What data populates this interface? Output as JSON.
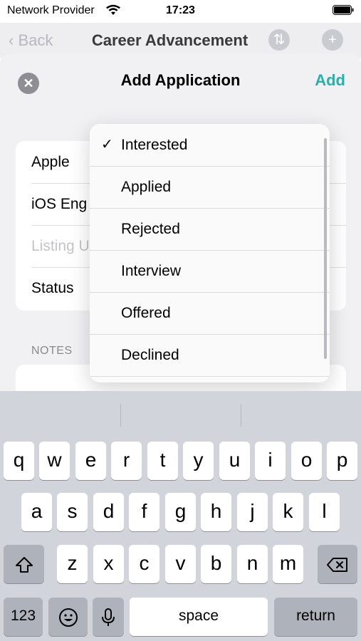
{
  "status_bar": {
    "carrier": "Network Provider",
    "time": "17:23"
  },
  "nav": {
    "back": "Back",
    "title": "Career Advancement"
  },
  "sheet": {
    "title": "Add Application",
    "add": "Add"
  },
  "form": {
    "company": "Apple",
    "position": "iOS Eng",
    "listing_placeholder": "Listing U",
    "status_label": "Status"
  },
  "notes": {
    "header": "NOTES"
  },
  "menu": {
    "selected": "Interested",
    "items": [
      "Interested",
      "Applied",
      "Rejected",
      "Interview",
      "Offered",
      "Declined"
    ]
  },
  "keyboard": {
    "row1": [
      "q",
      "w",
      "e",
      "r",
      "t",
      "y",
      "u",
      "i",
      "o",
      "p"
    ],
    "row2": [
      "a",
      "s",
      "d",
      "f",
      "g",
      "h",
      "j",
      "k",
      "l"
    ],
    "row3": [
      "z",
      "x",
      "c",
      "v",
      "b",
      "n",
      "m"
    ],
    "numbers": "123",
    "space": "space",
    "return": "return"
  }
}
